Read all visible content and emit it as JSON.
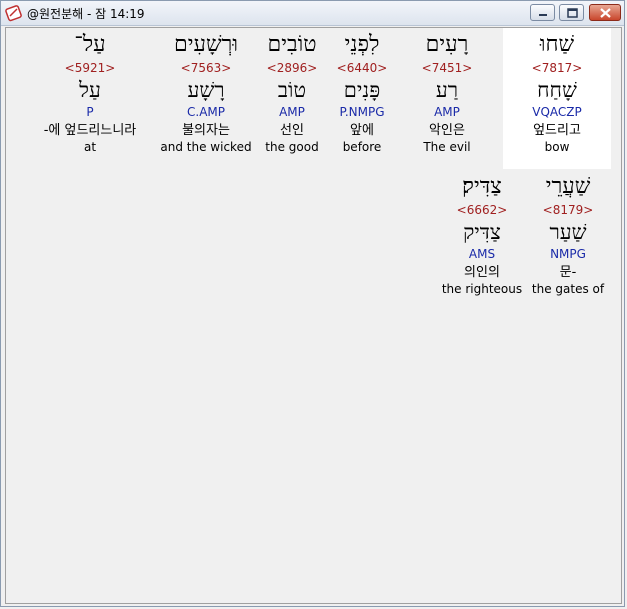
{
  "window": {
    "title": "@원전분해 - 잠 14:19"
  },
  "rows": [
    {
      "words": [
        {
          "hebrew": "שַׁחוּ",
          "strong": "<7817>",
          "lemma": "שָׁחַח",
          "morph": "VQACZP",
          "korean": "엎드리고",
          "english": "bow",
          "highlighted": true
        },
        {
          "hebrew": "רָעִים",
          "strong": "<7451>",
          "lemma": "רַע",
          "morph": "AMP",
          "korean": "악인은",
          "english": "The evil",
          "highlighted": false
        },
        {
          "hebrew": "לִפְנֵי",
          "strong": "<6440>",
          "lemma": "פָּנִים",
          "morph": "P.NMPG",
          "korean": "앞에",
          "english": "before",
          "highlighted": false
        },
        {
          "hebrew": "טוֹבִים",
          "strong": "<2896>",
          "lemma": "טוֹב",
          "morph": "AMP",
          "korean": "선인",
          "english": "the good",
          "highlighted": false
        },
        {
          "hebrew": "וּרְשָׁעִים",
          "strong": "<7563>",
          "lemma": "רָשָׁע",
          "morph": "C.AMP",
          "korean": "불의자는",
          "english": "and the wicked",
          "highlighted": false
        },
        {
          "hebrew": "עַל־",
          "strong": "<5921>",
          "lemma": "עַל",
          "morph": "P",
          "korean": "-에 엎드리느니라",
          "english": "at",
          "highlighted": false
        }
      ]
    },
    {
      "words": [
        {
          "hebrew": "שַׁעֲרֵי",
          "strong": "<8179>",
          "lemma": "שַׁעַר",
          "morph": "NMPG",
          "korean": "문-",
          "english": "the gates of",
          "highlighted": false
        },
        {
          "hebrew": "צַדִּיק׃",
          "strong": "<6662>",
          "lemma": "צַדִּיק",
          "morph": "AMS",
          "korean": "의인의",
          "english": "the righteous",
          "highlighted": false
        }
      ]
    }
  ]
}
